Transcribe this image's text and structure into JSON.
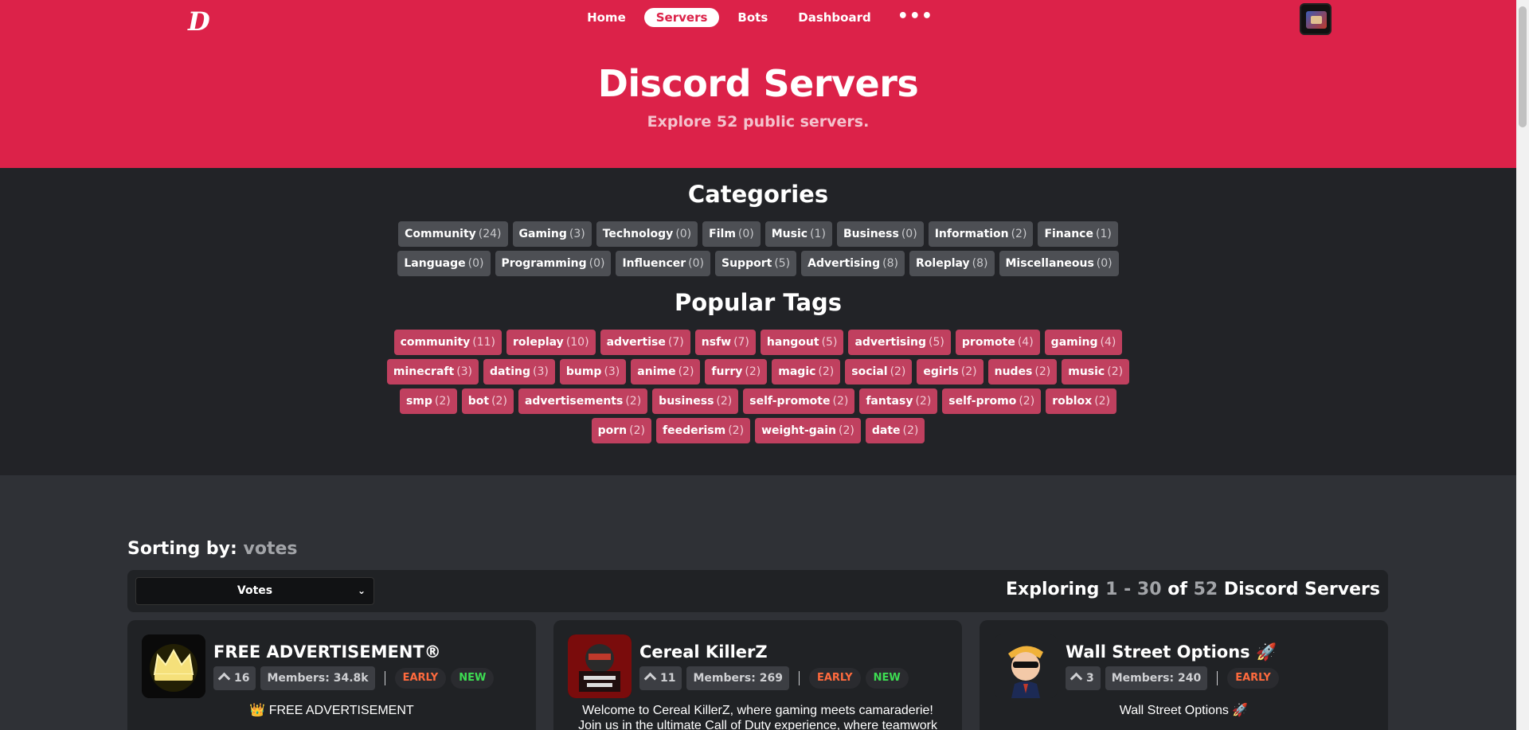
{
  "header": {
    "logo": "D",
    "nav": [
      {
        "label": "Home",
        "active": false
      },
      {
        "label": "Servers",
        "active": true
      },
      {
        "label": "Bots",
        "active": false
      },
      {
        "label": "Dashboard",
        "active": false
      }
    ],
    "more_label": "•••"
  },
  "hero": {
    "title": "Discord Servers",
    "subtitle": "Explore 52 public servers."
  },
  "categories": {
    "title": "Categories",
    "items": [
      {
        "label": "Community",
        "count": "(24)"
      },
      {
        "label": "Gaming",
        "count": "(3)"
      },
      {
        "label": "Technology",
        "count": "(0)"
      },
      {
        "label": "Film",
        "count": "(0)"
      },
      {
        "label": "Music",
        "count": "(1)"
      },
      {
        "label": "Business",
        "count": "(0)"
      },
      {
        "label": "Information",
        "count": "(2)"
      },
      {
        "label": "Finance",
        "count": "(1)"
      },
      {
        "label": "Language",
        "count": "(0)"
      },
      {
        "label": "Programming",
        "count": "(0)"
      },
      {
        "label": "Influencer",
        "count": "(0)"
      },
      {
        "label": "Support",
        "count": "(5)"
      },
      {
        "label": "Advertising",
        "count": "(8)"
      },
      {
        "label": "Roleplay",
        "count": "(8)"
      },
      {
        "label": "Miscellaneous",
        "count": "(0)"
      }
    ]
  },
  "tags": {
    "title": "Popular Tags",
    "items": [
      {
        "label": "community",
        "count": "(11)"
      },
      {
        "label": "roleplay",
        "count": "(10)"
      },
      {
        "label": "advertise",
        "count": "(7)"
      },
      {
        "label": "nsfw",
        "count": "(7)"
      },
      {
        "label": "hangout",
        "count": "(5)"
      },
      {
        "label": "advertising",
        "count": "(5)"
      },
      {
        "label": "promote",
        "count": "(4)"
      },
      {
        "label": "gaming",
        "count": "(4)"
      },
      {
        "label": "minecraft",
        "count": "(3)"
      },
      {
        "label": "dating",
        "count": "(3)"
      },
      {
        "label": "bump",
        "count": "(3)"
      },
      {
        "label": "anime",
        "count": "(2)"
      },
      {
        "label": "furry",
        "count": "(2)"
      },
      {
        "label": "magic",
        "count": "(2)"
      },
      {
        "label": "social",
        "count": "(2)"
      },
      {
        "label": "egirls",
        "count": "(2)"
      },
      {
        "label": "nudes",
        "count": "(2)"
      },
      {
        "label": "music",
        "count": "(2)"
      },
      {
        "label": "smp",
        "count": "(2)"
      },
      {
        "label": "bot",
        "count": "(2)"
      },
      {
        "label": "advertisements",
        "count": "(2)"
      },
      {
        "label": "business",
        "count": "(2)"
      },
      {
        "label": "self-promote",
        "count": "(2)"
      },
      {
        "label": "fantasy",
        "count": "(2)"
      },
      {
        "label": "self-promo",
        "count": "(2)"
      },
      {
        "label": "roblox",
        "count": "(2)"
      },
      {
        "label": "porn",
        "count": "(2)"
      },
      {
        "label": "feederism",
        "count": "(2)"
      },
      {
        "label": "weight-gain",
        "count": "(2)"
      },
      {
        "label": "date",
        "count": "(2)"
      }
    ]
  },
  "sorting": {
    "label": "Sorting by:",
    "value": "votes",
    "select_value": "Votes",
    "exploring_prefix": "Exploring",
    "range_start": "1",
    "range_sep": "-",
    "range_end": "30",
    "of_label": "of",
    "total": "52",
    "suffix": "Discord Servers"
  },
  "servers": [
    {
      "name": "FREE ADVERTISEMENT®",
      "votes": "16",
      "members": "Members: 34.8k",
      "badges": [
        "EARLY",
        "NEW"
      ],
      "description": "👑 FREE ADVERTISEMENT"
    },
    {
      "name": "Cereal KillerZ",
      "votes": "11",
      "members": "Members: 269",
      "badges": [
        "EARLY",
        "NEW"
      ],
      "description": "Welcome to Cereal KillerZ, where gaming meets camaraderie! Join us in the ultimate Call of Duty experience, where teamwork and support"
    },
    {
      "name": "Wall Street Options 🚀",
      "votes": "3",
      "members": "Members: 240",
      "badges": [
        "EARLY"
      ],
      "description": "Wall Street Options 🚀"
    }
  ],
  "colors": {
    "brand": "#dc2249",
    "tag": "#c0405f",
    "early": "#ff6a3d",
    "new": "#3ddc52"
  }
}
